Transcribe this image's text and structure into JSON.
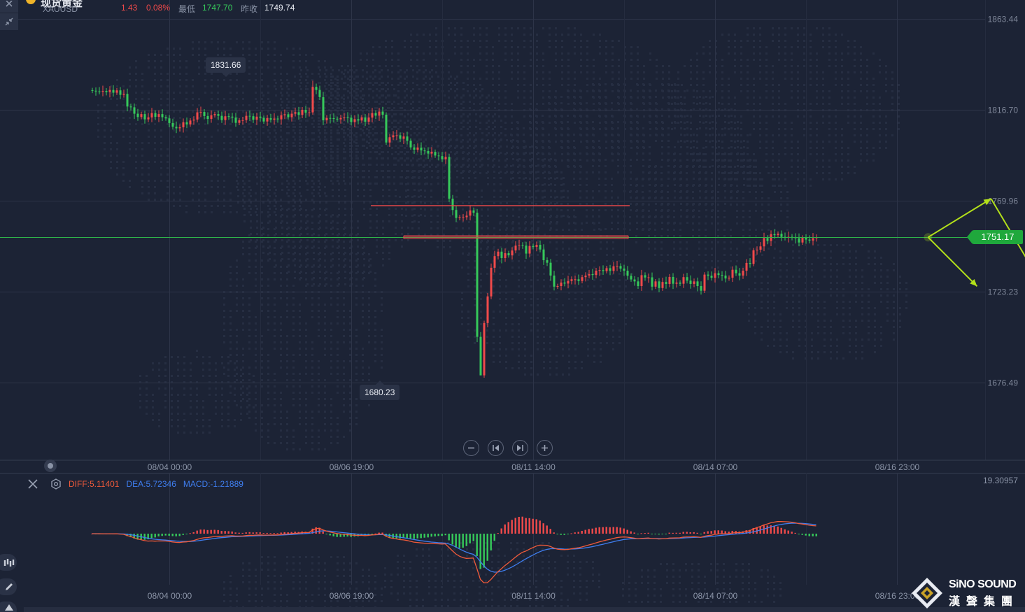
{
  "header": {
    "symbol_name": "现货黄金",
    "symbol_code": "XAUUSD",
    "change": "1.43",
    "change_pct": "0.08%",
    "low_label": "最低",
    "low_value": "1747.70",
    "prev_close_label": "昨收",
    "prev_close_value": "1749.74"
  },
  "colors": {
    "background": "#1c2335",
    "grid": "#2d3448",
    "up": "#f04a4a",
    "down": "#36c95a",
    "current_price_line": "#2fb34a",
    "resistance": "#f04a4a",
    "forecast_arrow": "#b3e01a",
    "diff_line": "#f05a3a",
    "dea_line": "#3f7ef0"
  },
  "current_price": "1751.17",
  "extremes": {
    "high": "1831.66",
    "low": "1680.23"
  },
  "macd": {
    "diff": "DIFF:5.11401",
    "dea": "DEA:5.72346",
    "macd": "MACD:-1.21889",
    "axis_max": "19.30957"
  },
  "logo": {
    "en": "SiNO SOUND",
    "cn": "漢聲集團"
  },
  "chart_data": {
    "type": "candlestick",
    "symbol": "XAUUSD",
    "y_ticks": [
      1863.44,
      1816.7,
      1769.96,
      1723.23,
      1676.49
    ],
    "y_tick_labels": [
      "1863.44",
      "1816.70",
      "1769.96",
      "1723.23",
      "1676.49"
    ],
    "ylim": [
      1634.7,
      1873.2
    ],
    "x_tick_labels": [
      "08/04 00:00",
      "08/06 19:00",
      "08/11 14:00",
      "08/14 07:00",
      "08/16 23:00"
    ],
    "bar_count": 246,
    "bars_per_x_tick": 52,
    "first_x_tick_bar": 22,
    "closes": [
      1826.5,
      1826.2,
      1826.1,
      1826.4,
      1825.8,
      1826.9,
      1825.5,
      1826.7,
      1824.4,
      1824.9,
      1818.4,
      1818.0,
      1814.7,
      1813.0,
      1814.5,
      1811.8,
      1812.8,
      1815.0,
      1813.1,
      1814.5,
      1812.9,
      1812.3,
      1809.9,
      1808.0,
      1807.2,
      1807.7,
      1810.3,
      1809.2,
      1811.2,
      1811.7,
      1815.4,
      1815.6,
      1813.5,
      1812.0,
      1813.9,
      1814.5,
      1813.6,
      1811.4,
      1813.4,
      1813.2,
      1812.7,
      1810.0,
      1811.3,
      1811.4,
      1813.6,
      1813.4,
      1811.6,
      1813.2,
      1812.6,
      1810.7,
      1812.4,
      1811.6,
      1812.2,
      1811.8,
      1813.9,
      1814.4,
      1812.9,
      1814.7,
      1815.5,
      1814.1,
      1816.7,
      1815.2,
      1815.4,
      1828.5,
      1826.9,
      1823.2,
      1811.3,
      1812.5,
      1812.4,
      1812.1,
      1811.8,
      1812.5,
      1812.8,
      1812.6,
      1810.4,
      1811.9,
      1811.2,
      1812.8,
      1810.6,
      1812.7,
      1815.0,
      1813.7,
      1815.8,
      1814.2,
      1799.9,
      1802.6,
      1803.6,
      1803.6,
      1801.8,
      1803.0,
      1800.8,
      1797.4,
      1796.2,
      1797.3,
      1795.8,
      1795.5,
      1794.2,
      1795.1,
      1793.2,
      1792.9,
      1791.3,
      1792.5,
      1771.0,
      1765.2,
      1761.1,
      1761.5,
      1761.5,
      1762.3,
      1765.0,
      1763.8,
      1700.0,
      1680.2,
      1707.1,
      1720.8,
      1735.5,
      1741.5,
      1743.8,
      1740.5,
      1743.0,
      1741.9,
      1744.4,
      1746.9,
      1747.2,
      1746.9,
      1742.8,
      1746.7,
      1746.2,
      1747.3,
      1744.9,
      1739.4,
      1738.1,
      1731.5,
      1725.8,
      1726.1,
      1727.9,
      1727.4,
      1728.7,
      1729.6,
      1729.6,
      1728.7,
      1730.7,
      1731.5,
      1732.2,
      1731.8,
      1734.0,
      1734.3,
      1733.8,
      1735.3,
      1733.9,
      1736.3,
      1736.4,
      1735.1,
      1734.0,
      1731.4,
      1729.5,
      1728.5,
      1726.1,
      1731.7,
      1730.5,
      1730.6,
      1725.8,
      1728.5,
      1725.1,
      1728.2,
      1727.2,
      1730.8,
      1727.3,
      1727.9,
      1727.3,
      1730.7,
      1728.9,
      1727.2,
      1728.5,
      1726.1,
      1723.7,
      1732.0,
      1731.4,
      1730.4,
      1732.7,
      1731.8,
      1731.5,
      1730.0,
      1730.4,
      1734.5,
      1732.7,
      1731.5,
      1734.0,
      1738.0,
      1737.5,
      1744.5,
      1744.8,
      1746.5,
      1750.8,
      1749.3,
      1752.8,
      1752.3,
      1753.0,
      1751.4,
      1751.0,
      1751.4,
      1751.3,
      1750.7,
      1748.5,
      1751.0,
      1750.0,
      1749.5,
      1750.7,
      1751.2
    ],
    "current_price": 1751.17,
    "high_marker": 1831.66,
    "low_marker": 1680.23,
    "annotations": {
      "resistance_lines": [
        1767.4,
        1752.0,
        1751.3,
        1750.5
      ],
      "forecast_paths": [
        {
          "points": [
            [
              238,
              1751.2
            ],
            [
              256,
              1771.0
            ],
            [
              271,
              1725.5
            ]
          ]
        },
        {
          "points": [
            [
              238,
              1751.2
            ],
            [
              252,
              1726.0
            ]
          ]
        }
      ]
    },
    "macd_panel": {
      "axis_max": 19.30957,
      "diff": 5.11401,
      "dea": 5.72346,
      "macd": -1.21889
    }
  }
}
